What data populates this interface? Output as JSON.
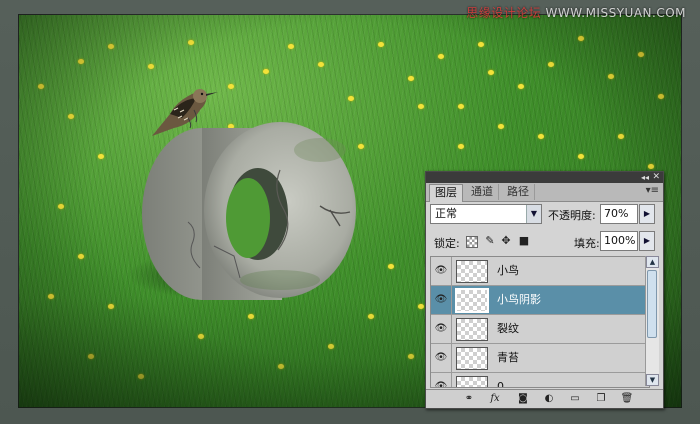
{
  "watermark": {
    "red": "思缘设计论坛",
    "white": "WWW.MISSYUAN.COM"
  },
  "panel": {
    "tabs": [
      "图层",
      "通道",
      "路径"
    ],
    "active_tab": 0,
    "blend_mode": "正常",
    "opacity_label": "不透明度:",
    "opacity_value": "70%",
    "lock_label": "锁定:",
    "fill_label": "填充:",
    "fill_value": "100%",
    "layers": [
      {
        "name": "小鸟",
        "selected": false
      },
      {
        "name": "小鸟阴影",
        "selected": true
      },
      {
        "name": "裂纹",
        "selected": false
      },
      {
        "name": "青苔",
        "selected": false
      },
      {
        "name": "0",
        "selected": false
      }
    ],
    "bottom_icons": [
      "link-icon",
      "fx-icon",
      "layer-mask-icon",
      "adjustment-layer-icon",
      "new-group-icon",
      "new-layer-icon",
      "trash-icon"
    ]
  },
  "colors": {
    "selected_layer": "#5a8fa8",
    "grass": "#3f8f2a",
    "flower": "#f2e23a"
  }
}
